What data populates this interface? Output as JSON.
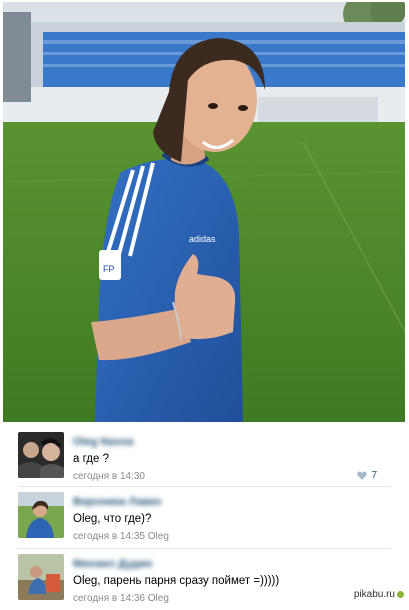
{
  "photo": {
    "jersey_brand": "adidas",
    "patch_text": "FP"
  },
  "comments": [
    {
      "author": "Oleg Navoa",
      "text": "а где ?",
      "meta": "сегодня в 14:30",
      "likes": "7"
    },
    {
      "author": "Вероника Лавко",
      "text": "Oleg, что где)?",
      "meta": "сегодня в 14:35 Oleg"
    },
    {
      "author": "Михаил Дудин",
      "text": "Oleg, парень парня сразу поймет =)))))",
      "meta": "сегодня в 14:36 Oleg"
    }
  ],
  "watermark": "pikabu.ru",
  "colors": {
    "link": "#2b587a",
    "meta": "#8a8a8a",
    "jersey": "#2a5fb0",
    "grass": "#4e8a2c"
  },
  "icons": [
    "heart-icon",
    "pikabu-logo-icon"
  ]
}
